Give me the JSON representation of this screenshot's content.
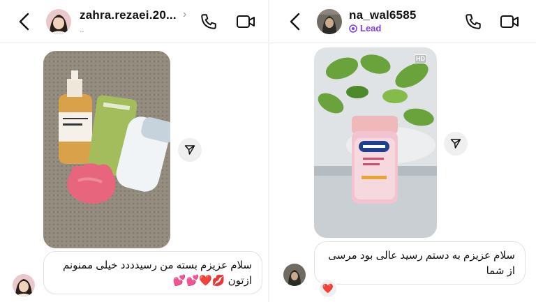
{
  "left_chat": {
    "username": "zahra.rezaei.20...",
    "subtitle": "..",
    "message": "سلام عزیزم بسته من رسیدددد خیلی ممنونم ازتون 💋❤️💕💕"
  },
  "right_chat": {
    "username": "na_wal6585",
    "badge_label": "Lead",
    "message": "سلام عزیزم به دستم رسید عالی بود مرسی از شما",
    "hd_label": "HD",
    "reaction": "❤️"
  },
  "icons": {
    "back": "chevron-left-icon",
    "chevron": "chevron-right-icon",
    "call": "phone-icon",
    "video": "video-camera-icon",
    "share": "send-icon",
    "lead": "lead-badge-icon"
  },
  "colors": {
    "lead": "#7b3fe4",
    "heart": "#e8283c",
    "bubble_border": "#e2e2e2",
    "share_bg": "#efefef"
  }
}
